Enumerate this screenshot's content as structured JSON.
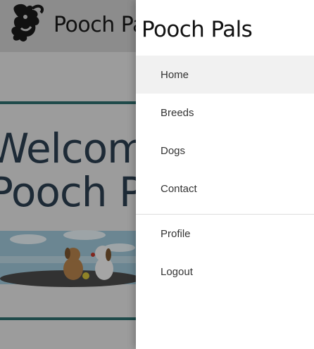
{
  "background": {
    "header_title": "Pooch Pal",
    "hero_line_1": "Welcome t",
    "hero_line_2": "Pooch Pal"
  },
  "drawer": {
    "title": "Pooch Pals",
    "primary_items": [
      {
        "label": "Home"
      },
      {
        "label": "Breeds"
      },
      {
        "label": "Dogs"
      },
      {
        "label": "Contact"
      }
    ],
    "secondary_items": [
      {
        "label": "Profile"
      },
      {
        "label": "Logout"
      }
    ]
  },
  "colors": {
    "accent_teal": "#2f6d6d",
    "drawer_bg": "#ffffff",
    "active_item_bg": "#f1f1f1"
  },
  "icons": {
    "logo": "dog-logo-icon"
  }
}
